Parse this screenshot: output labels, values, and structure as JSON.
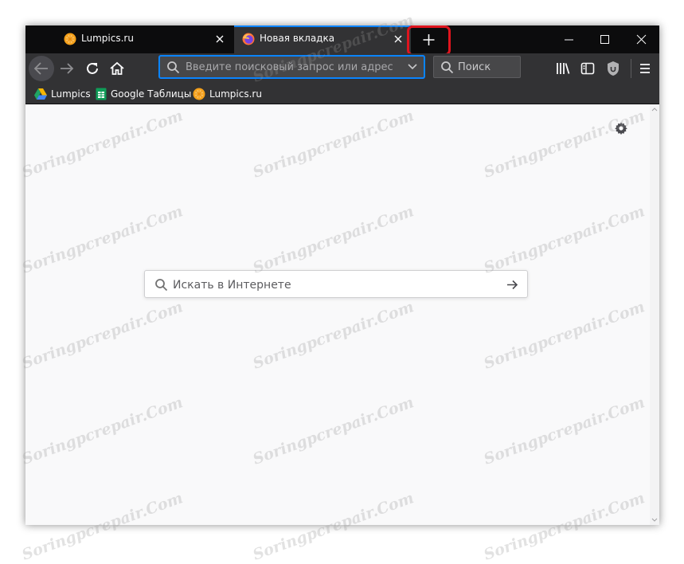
{
  "tabs": [
    {
      "label": "Lumpics.ru",
      "active": false,
      "icon": "lumpics-orange-icon"
    },
    {
      "label": "Новая вкладка",
      "active": true,
      "icon": "firefox-icon"
    }
  ],
  "new_tab_symbol": "+",
  "navbar": {
    "url_placeholder": "Введите поисковый запрос или адрес",
    "search_placeholder": "Поиск"
  },
  "bookmarks": [
    {
      "label": "Lumpics",
      "icon": "google-drive-icon"
    },
    {
      "label": "Google Таблицы",
      "icon": "google-sheets-icon"
    },
    {
      "label": "Lumpics.ru",
      "icon": "lumpics-orange-icon"
    }
  ],
  "content": {
    "search_placeholder": "Искать в Интернете"
  },
  "watermark": "Soringpcrepair.Com",
  "colors": {
    "highlight": "#e0141e",
    "accent": "#0a84ff",
    "dark": "#0c0c0d",
    "toolbar": "#323234"
  }
}
